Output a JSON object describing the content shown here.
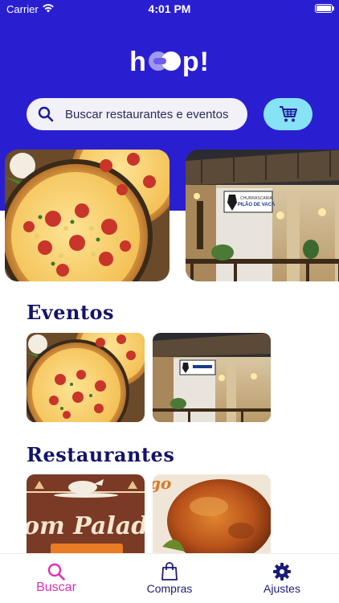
{
  "status_bar": {
    "carrier": "Carrier",
    "time": "4:01 PM"
  },
  "app": {
    "logo_prefix": "h",
    "logo_suffix": "p!"
  },
  "search": {
    "placeholder": "Buscar restaurantes e eventos"
  },
  "carousel": [
    {
      "kind": "pizza"
    },
    {
      "kind": "restaurant",
      "sign_line1": "CHURRASCARIA",
      "sign_line2": "PILÃO DE VACA"
    }
  ],
  "sections": {
    "eventos": {
      "title": "Eventos"
    },
    "restaurantes": {
      "title": "Restaurantes",
      "card1_text": "om Palad",
      "card2_text": "go"
    }
  },
  "tabs": [
    {
      "label": "Buscar",
      "icon": "search-icon",
      "active": true
    },
    {
      "label": "Compras",
      "icon": "bag-icon",
      "active": false
    },
    {
      "label": "Ajustes",
      "icon": "gear-icon",
      "active": false
    }
  ],
  "colors": {
    "header": "#2a1fd0",
    "cart_button": "#86e3f5",
    "section_title": "#14146a",
    "tab_active": "#e02fb5",
    "tab_inactive": "#1b1b7a"
  }
}
